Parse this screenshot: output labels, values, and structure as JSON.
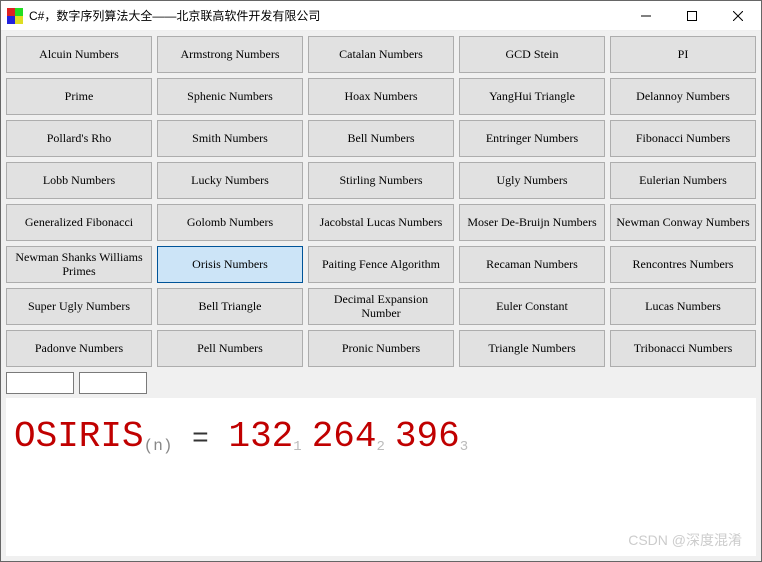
{
  "window": {
    "title": "C#，数字序列算法大全——北京联高软件开发有限公司"
  },
  "buttons": [
    {
      "label": "Alcuin Numbers",
      "selected": false
    },
    {
      "label": "Armstrong Numbers",
      "selected": false
    },
    {
      "label": "Catalan Numbers",
      "selected": false
    },
    {
      "label": "GCD Stein",
      "selected": false
    },
    {
      "label": "PI",
      "selected": false
    },
    {
      "label": "Prime",
      "selected": false
    },
    {
      "label": "Sphenic Numbers",
      "selected": false
    },
    {
      "label": "Hoax Numbers",
      "selected": false
    },
    {
      "label": "YangHui Triangle",
      "selected": false
    },
    {
      "label": "Delannoy Numbers",
      "selected": false
    },
    {
      "label": "Pollard's Rho",
      "selected": false
    },
    {
      "label": "Smith Numbers",
      "selected": false
    },
    {
      "label": "Bell Numbers",
      "selected": false
    },
    {
      "label": "Entringer Numbers",
      "selected": false
    },
    {
      "label": "Fibonacci Numbers",
      "selected": false
    },
    {
      "label": "Lobb Numbers",
      "selected": false
    },
    {
      "label": "Lucky Numbers",
      "selected": false
    },
    {
      "label": "Stirling Numbers",
      "selected": false
    },
    {
      "label": "Ugly Numbers",
      "selected": false
    },
    {
      "label": "Eulerian Numbers",
      "selected": false
    },
    {
      "label": "Generalized Fibonacci",
      "selected": false
    },
    {
      "label": "Golomb Numbers",
      "selected": false
    },
    {
      "label": "Jacobstal Lucas Numbers",
      "selected": false
    },
    {
      "label": "Moser De-Bruijn Numbers",
      "selected": false
    },
    {
      "label": "Newman Conway Numbers",
      "selected": false
    },
    {
      "label": "Newman Shanks Williams Primes",
      "selected": false
    },
    {
      "label": "Orisis Numbers",
      "selected": true
    },
    {
      "label": "Paiting Fence Algorithm",
      "selected": false
    },
    {
      "label": "Recaman Numbers",
      "selected": false
    },
    {
      "label": "Rencontres Numbers",
      "selected": false
    },
    {
      "label": "Super Ugly Numbers",
      "selected": false
    },
    {
      "label": "Bell Triangle",
      "selected": false
    },
    {
      "label": "Decimal Expansion Number",
      "selected": false
    },
    {
      "label": "Euler Constant",
      "selected": false
    },
    {
      "label": "Lucas Numbers",
      "selected": false
    },
    {
      "label": "Padonve Numbers",
      "selected": false
    },
    {
      "label": "Pell Numbers",
      "selected": false
    },
    {
      "label": "Pronic Numbers",
      "selected": false
    },
    {
      "label": "Triangle Numbers",
      "selected": false
    },
    {
      "label": "Tribonacci Numbers",
      "selected": false
    }
  ],
  "inputs": {
    "input1": "",
    "input2": ""
  },
  "output": {
    "name": "OSIRIS",
    "subscript": "(n)",
    "eq": "=",
    "sequence": [
      {
        "value": "132",
        "index": "1"
      },
      {
        "value": "264",
        "index": "2"
      },
      {
        "value": "396",
        "index": "3"
      }
    ]
  },
  "watermark": "CSDN @深度混淆"
}
